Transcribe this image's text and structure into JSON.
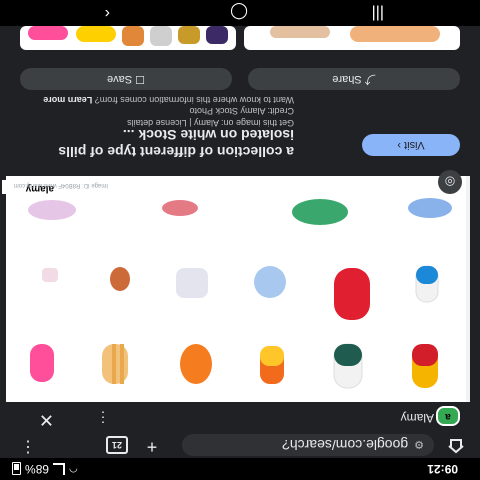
{
  "status": {
    "time": "09:21",
    "battery": "68%"
  },
  "browser": {
    "url": "google.com/search?",
    "tab_count": "21"
  },
  "viewer": {
    "source": "Alamy",
    "title": "a collection of different type of pills isolated on white Stock ...",
    "visit_label": "Visit",
    "get_image": "Get this image on: Alamy | License details",
    "credit": "Credit: Alamy Stock Photo",
    "info_question": "Want to know where this information comes from?",
    "learn_more": "Learn more",
    "share_label": "Share",
    "save_label": "Save",
    "watermark": "alamy",
    "watermark_credit": "Image ID: R8B04F www.alamy.com"
  },
  "icons": {
    "home": "home-icon",
    "new_tab": "plus-icon",
    "menu": "more-vert-icon",
    "close": "close-icon",
    "lens": "lens-icon",
    "share": "share-icon",
    "save": "bookmark-icon"
  }
}
